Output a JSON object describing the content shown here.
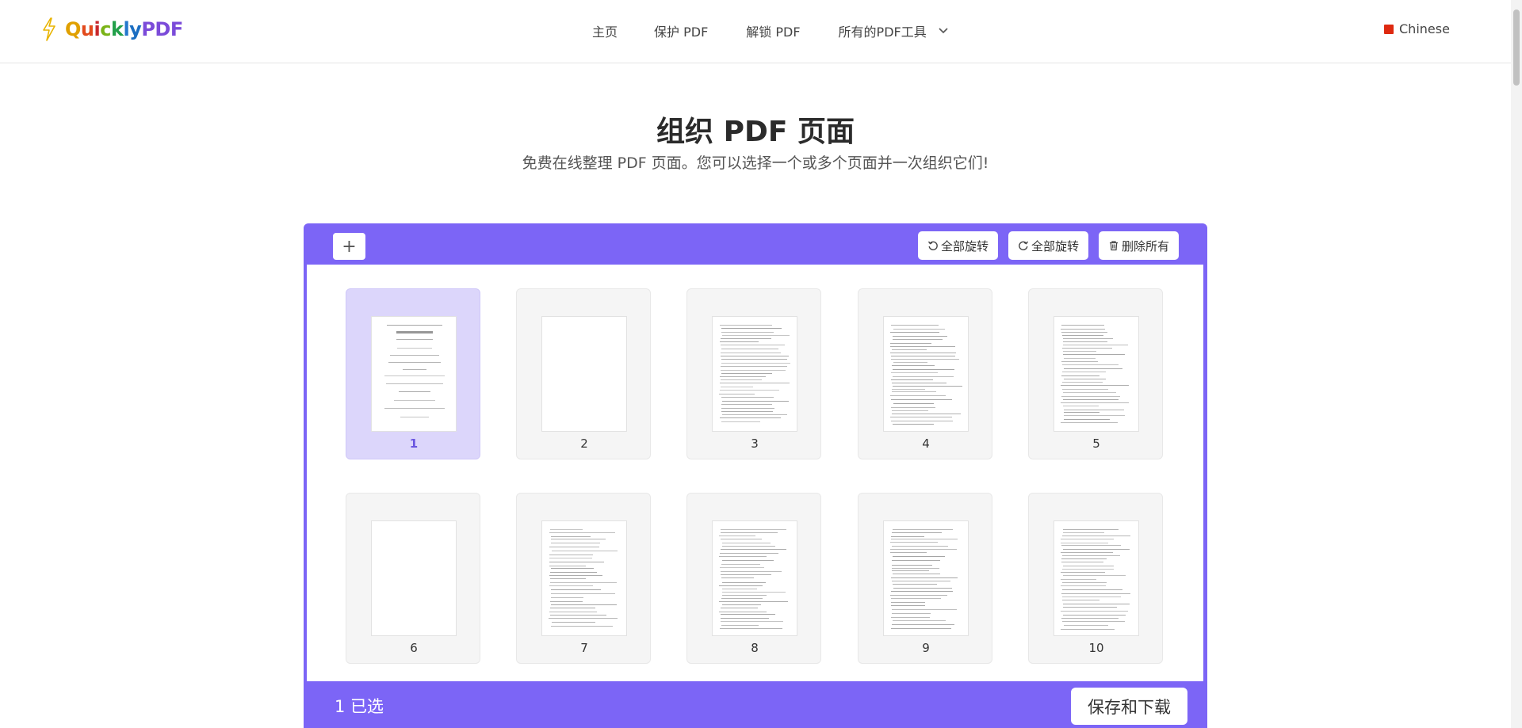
{
  "header": {
    "logo": {
      "text_quickly": "Quickly",
      "text_pdf": "PDF"
    },
    "nav": [
      "主页",
      "保护 PDF",
      "解锁 PDF",
      "所有的PDF工具"
    ],
    "language": "Chinese"
  },
  "hero": {
    "title": "组织 PDF 页面",
    "subtitle": "免费在线整理 PDF 页面。您可以选择一个或多个页面并一次组织它们!"
  },
  "toolbar": {
    "add_label": "+",
    "rotate_left_label": "全部旋转",
    "rotate_right_label": "全部旋转",
    "delete_all_label": "删除所有"
  },
  "pages": [
    {
      "number": "1",
      "selected": true
    },
    {
      "number": "2",
      "selected": false
    },
    {
      "number": "3",
      "selected": false
    },
    {
      "number": "4",
      "selected": false
    },
    {
      "number": "5",
      "selected": false
    },
    {
      "number": "6",
      "selected": false
    },
    {
      "number": "7",
      "selected": false
    },
    {
      "number": "8",
      "selected": false
    },
    {
      "number": "9",
      "selected": false
    },
    {
      "number": "10",
      "selected": false
    }
  ],
  "footer": {
    "selected_count": "1 已选",
    "save_label": "保存和下载"
  },
  "colors": {
    "accent": "#7c65f6",
    "selected_card": "#dcd6fb",
    "flag": "#de2910"
  }
}
